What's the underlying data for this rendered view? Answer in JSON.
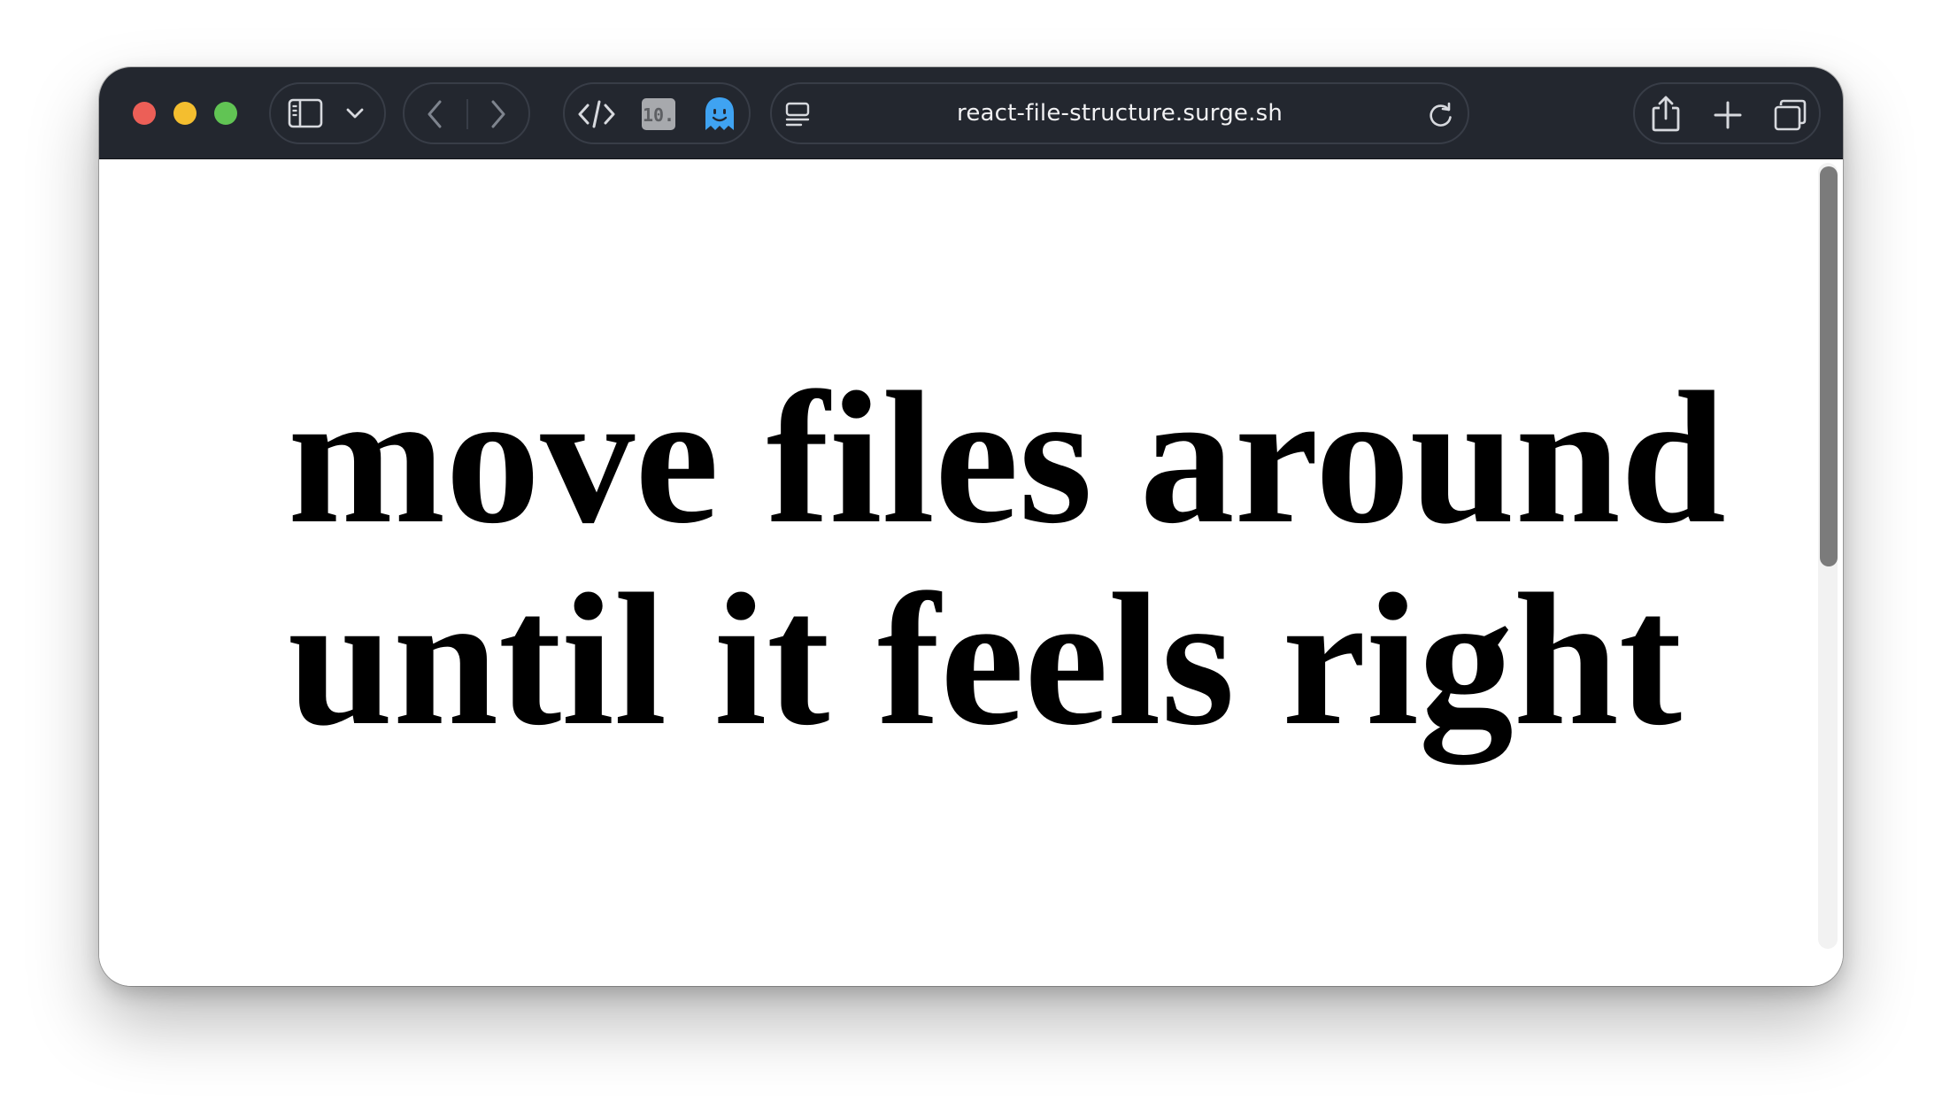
{
  "colors": {
    "traffic_close": "#ec5f57",
    "traffic_minimize": "#f4be2f",
    "traffic_maximize": "#61c454",
    "titlebar": "#23272f",
    "ghost_icon": "#3fa3f2"
  },
  "toolbar": {
    "extension_badge": "10.",
    "icons": [
      "sidebar-icon",
      "chevron-down-icon",
      "back-icon",
      "forward-icon",
      "code-icon",
      "ghost-icon",
      "reader-icon",
      "reload-icon",
      "share-icon",
      "new-tab-icon",
      "tabs-overview-icon"
    ]
  },
  "address_bar": {
    "url": "react-file-structure.surge.sh"
  },
  "page": {
    "headline_line1": "move files around",
    "headline_line2": "until it feels right"
  },
  "scrollbar": {
    "position_fraction": 0.0
  }
}
